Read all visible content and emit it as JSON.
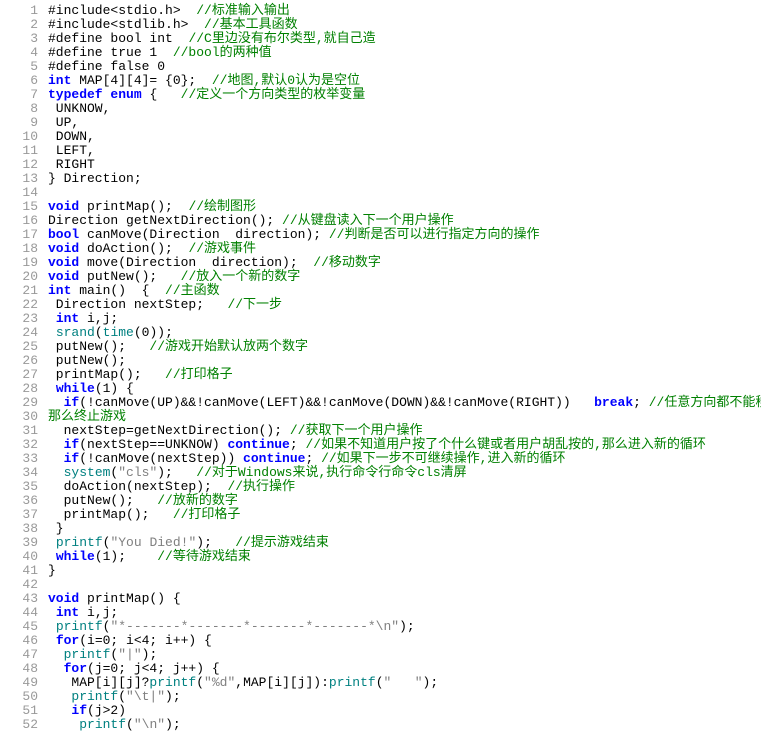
{
  "editor": {
    "lines": [
      {
        "n": 1,
        "segs": [
          {
            "c": "plain",
            "t": "#include<stdio.h>  "
          },
          {
            "c": "cmt",
            "t": "//标准输入输出"
          }
        ]
      },
      {
        "n": 2,
        "segs": [
          {
            "c": "plain",
            "t": "#include<stdlib.h>  "
          },
          {
            "c": "cmt",
            "t": "//基本工具函数"
          }
        ]
      },
      {
        "n": 3,
        "segs": [
          {
            "c": "plain",
            "t": "#define bool int  "
          },
          {
            "c": "cmt",
            "t": "//C里边没有布尔类型,就自己造"
          }
        ]
      },
      {
        "n": 4,
        "segs": [
          {
            "c": "plain",
            "t": "#define true 1  "
          },
          {
            "c": "cmt",
            "t": "//bool的两种值"
          }
        ]
      },
      {
        "n": 5,
        "segs": [
          {
            "c": "plain",
            "t": "#define false 0"
          }
        ]
      },
      {
        "n": 6,
        "segs": [
          {
            "c": "kw",
            "t": "int"
          },
          {
            "c": "plain",
            "t": " MAP[4][4]= {0};  "
          },
          {
            "c": "cmt",
            "t": "//地图,默认0认为是空位"
          }
        ]
      },
      {
        "n": 7,
        "segs": [
          {
            "c": "kw2",
            "t": "typedef"
          },
          {
            "c": "plain",
            "t": " "
          },
          {
            "c": "kw2",
            "t": "enum"
          },
          {
            "c": "plain",
            "t": " {   "
          },
          {
            "c": "cmt",
            "t": "//定义一个方向类型的枚举变量"
          }
        ]
      },
      {
        "n": 8,
        "segs": [
          {
            "c": "plain",
            "t": " UNKNOW,"
          }
        ]
      },
      {
        "n": 9,
        "segs": [
          {
            "c": "plain",
            "t": " UP,"
          }
        ]
      },
      {
        "n": 10,
        "segs": [
          {
            "c": "plain",
            "t": " DOWN,"
          }
        ]
      },
      {
        "n": 11,
        "segs": [
          {
            "c": "plain",
            "t": " LEFT,"
          }
        ]
      },
      {
        "n": 12,
        "segs": [
          {
            "c": "plain",
            "t": " RIGHT"
          }
        ]
      },
      {
        "n": 13,
        "segs": [
          {
            "c": "plain",
            "t": "} Direction;"
          }
        ]
      },
      {
        "n": 14,
        "segs": [
          {
            "c": "plain",
            "t": ""
          }
        ]
      },
      {
        "n": 15,
        "segs": [
          {
            "c": "kw",
            "t": "void"
          },
          {
            "c": "plain",
            "t": " printMap();  "
          },
          {
            "c": "cmt",
            "t": "//绘制图形"
          }
        ]
      },
      {
        "n": 16,
        "segs": [
          {
            "c": "plain",
            "t": "Direction getNextDirection(); "
          },
          {
            "c": "cmt",
            "t": "//从键盘读入下一个用户操作"
          }
        ]
      },
      {
        "n": 17,
        "segs": [
          {
            "c": "kw",
            "t": "bool"
          },
          {
            "c": "plain",
            "t": " canMove(Direction  direction); "
          },
          {
            "c": "cmt",
            "t": "//判断是否可以进行指定方向的操作"
          }
        ]
      },
      {
        "n": 18,
        "segs": [
          {
            "c": "kw",
            "t": "void"
          },
          {
            "c": "plain",
            "t": " doAction();  "
          },
          {
            "c": "cmt",
            "t": "//游戏事件"
          }
        ]
      },
      {
        "n": 19,
        "segs": [
          {
            "c": "kw",
            "t": "void"
          },
          {
            "c": "plain",
            "t": " move(Direction  direction);  "
          },
          {
            "c": "cmt",
            "t": "//移动数字"
          }
        ]
      },
      {
        "n": 20,
        "segs": [
          {
            "c": "kw",
            "t": "void"
          },
          {
            "c": "plain",
            "t": " putNew();   "
          },
          {
            "c": "cmt",
            "t": "//放入一个新的数字"
          }
        ]
      },
      {
        "n": 21,
        "segs": [
          {
            "c": "kw",
            "t": "int"
          },
          {
            "c": "plain",
            "t": " main()  {  "
          },
          {
            "c": "cmt",
            "t": "//主函数"
          }
        ]
      },
      {
        "n": 22,
        "segs": [
          {
            "c": "plain",
            "t": " Direction nextStep;   "
          },
          {
            "c": "cmt",
            "t": "//下一步"
          }
        ]
      },
      {
        "n": 23,
        "segs": [
          {
            "c": "plain",
            "t": " "
          },
          {
            "c": "kw",
            "t": "int"
          },
          {
            "c": "plain",
            "t": " i,j;"
          }
        ]
      },
      {
        "n": 24,
        "segs": [
          {
            "c": "plain",
            "t": " "
          },
          {
            "c": "teal",
            "t": "srand"
          },
          {
            "c": "plain",
            "t": "("
          },
          {
            "c": "teal",
            "t": "time"
          },
          {
            "c": "plain",
            "t": "(0));"
          }
        ]
      },
      {
        "n": 25,
        "segs": [
          {
            "c": "plain",
            "t": " putNew();   "
          },
          {
            "c": "cmt",
            "t": "//游戏开始默认放两个数字"
          }
        ]
      },
      {
        "n": 26,
        "segs": [
          {
            "c": "plain",
            "t": " putNew();"
          }
        ]
      },
      {
        "n": 27,
        "segs": [
          {
            "c": "plain",
            "t": " printMap();   "
          },
          {
            "c": "cmt",
            "t": "//打印格子"
          }
        ]
      },
      {
        "n": 28,
        "segs": [
          {
            "c": "plain",
            "t": " "
          },
          {
            "c": "kw",
            "t": "while"
          },
          {
            "c": "plain",
            "t": "(1) {"
          }
        ]
      },
      {
        "n": 29,
        "segs": [
          {
            "c": "plain",
            "t": "  "
          },
          {
            "c": "kw",
            "t": "if"
          },
          {
            "c": "plain",
            "t": "(!canMove(UP)&&!canMove(LEFT)&&!canMove(DOWN)&&!canMove(RIGHT))   "
          },
          {
            "c": "kw",
            "t": "break"
          },
          {
            "c": "plain",
            "t": "; "
          },
          {
            "c": "cmt",
            "t": "//任意方向都不能移动,"
          }
        ]
      },
      {
        "n": 30,
        "segs": [
          {
            "c": "cmt",
            "t": "那么终止游戏"
          }
        ]
      },
      {
        "n": 31,
        "segs": [
          {
            "c": "plain",
            "t": "  nextStep=getNextDirection(); "
          },
          {
            "c": "cmt",
            "t": "//获取下一个用户操作"
          }
        ]
      },
      {
        "n": 32,
        "segs": [
          {
            "c": "plain",
            "t": "  "
          },
          {
            "c": "kw",
            "t": "if"
          },
          {
            "c": "plain",
            "t": "(nextStep==UNKNOW) "
          },
          {
            "c": "kw",
            "t": "continue"
          },
          {
            "c": "plain",
            "t": "; "
          },
          {
            "c": "cmt",
            "t": "//如果不知道用户按了个什么键或者用户胡乱按的,那么进入新的循环"
          }
        ]
      },
      {
        "n": 33,
        "segs": [
          {
            "c": "plain",
            "t": "  "
          },
          {
            "c": "kw",
            "t": "if"
          },
          {
            "c": "plain",
            "t": "(!canMove(nextStep)) "
          },
          {
            "c": "kw",
            "t": "continue"
          },
          {
            "c": "plain",
            "t": "; "
          },
          {
            "c": "cmt",
            "t": "//如果下一步不可继续操作,进入新的循环"
          }
        ]
      },
      {
        "n": 34,
        "segs": [
          {
            "c": "plain",
            "t": "  "
          },
          {
            "c": "teal",
            "t": "system"
          },
          {
            "c": "plain",
            "t": "("
          },
          {
            "c": "str",
            "t": "\"cls\""
          },
          {
            "c": "plain",
            "t": ");   "
          },
          {
            "c": "cmt",
            "t": "//对于Windows来说,执行命令行命令cls清屏"
          }
        ]
      },
      {
        "n": 35,
        "segs": [
          {
            "c": "plain",
            "t": "  doAction(nextStep);  "
          },
          {
            "c": "cmt",
            "t": "//执行操作"
          }
        ]
      },
      {
        "n": 36,
        "segs": [
          {
            "c": "plain",
            "t": "  putNew();   "
          },
          {
            "c": "cmt",
            "t": "//放新的数字"
          }
        ]
      },
      {
        "n": 37,
        "segs": [
          {
            "c": "plain",
            "t": "  printMap();   "
          },
          {
            "c": "cmt",
            "t": "//打印格子"
          }
        ]
      },
      {
        "n": 38,
        "segs": [
          {
            "c": "plain",
            "t": " }"
          }
        ]
      },
      {
        "n": 39,
        "segs": [
          {
            "c": "plain",
            "t": " "
          },
          {
            "c": "teal",
            "t": "printf"
          },
          {
            "c": "plain",
            "t": "("
          },
          {
            "c": "str",
            "t": "\"You Died!\""
          },
          {
            "c": "plain",
            "t": ");   "
          },
          {
            "c": "cmt",
            "t": "//提示游戏结束"
          }
        ]
      },
      {
        "n": 40,
        "segs": [
          {
            "c": "plain",
            "t": " "
          },
          {
            "c": "kw",
            "t": "while"
          },
          {
            "c": "plain",
            "t": "(1);    "
          },
          {
            "c": "cmt",
            "t": "//等待游戏结束"
          }
        ]
      },
      {
        "n": 41,
        "segs": [
          {
            "c": "plain",
            "t": "}"
          }
        ]
      },
      {
        "n": 42,
        "segs": [
          {
            "c": "plain",
            "t": ""
          }
        ]
      },
      {
        "n": 43,
        "segs": [
          {
            "c": "kw",
            "t": "void"
          },
          {
            "c": "plain",
            "t": " printMap() {"
          }
        ]
      },
      {
        "n": 44,
        "segs": [
          {
            "c": "plain",
            "t": " "
          },
          {
            "c": "kw",
            "t": "int"
          },
          {
            "c": "plain",
            "t": " i,j;"
          }
        ]
      },
      {
        "n": 45,
        "segs": [
          {
            "c": "plain",
            "t": " "
          },
          {
            "c": "teal",
            "t": "printf"
          },
          {
            "c": "plain",
            "t": "("
          },
          {
            "c": "str",
            "t": "\"*-------*-------*-------*-------*\\n\""
          },
          {
            "c": "plain",
            "t": ");"
          }
        ]
      },
      {
        "n": 46,
        "segs": [
          {
            "c": "plain",
            "t": " "
          },
          {
            "c": "kw",
            "t": "for"
          },
          {
            "c": "plain",
            "t": "(i=0; i<4; i++) {"
          }
        ]
      },
      {
        "n": 47,
        "segs": [
          {
            "c": "plain",
            "t": "  "
          },
          {
            "c": "teal",
            "t": "printf"
          },
          {
            "c": "plain",
            "t": "("
          },
          {
            "c": "str",
            "t": "\"|\""
          },
          {
            "c": "plain",
            "t": ");"
          }
        ]
      },
      {
        "n": 48,
        "segs": [
          {
            "c": "plain",
            "t": "  "
          },
          {
            "c": "kw",
            "t": "for"
          },
          {
            "c": "plain",
            "t": "(j=0; j<4; j++) {"
          }
        ]
      },
      {
        "n": 49,
        "segs": [
          {
            "c": "plain",
            "t": "   MAP[i][j]?"
          },
          {
            "c": "teal",
            "t": "printf"
          },
          {
            "c": "plain",
            "t": "("
          },
          {
            "c": "str",
            "t": "\"%d\""
          },
          {
            "c": "plain",
            "t": ",MAP[i][j]):"
          },
          {
            "c": "teal",
            "t": "printf"
          },
          {
            "c": "plain",
            "t": "("
          },
          {
            "c": "str",
            "t": "\"   \""
          },
          {
            "c": "plain",
            "t": ");"
          }
        ]
      },
      {
        "n": 50,
        "segs": [
          {
            "c": "plain",
            "t": "   "
          },
          {
            "c": "teal",
            "t": "printf"
          },
          {
            "c": "plain",
            "t": "("
          },
          {
            "c": "str",
            "t": "\"\\t|\""
          },
          {
            "c": "plain",
            "t": ");"
          }
        ]
      },
      {
        "n": 51,
        "segs": [
          {
            "c": "plain",
            "t": "   "
          },
          {
            "c": "kw",
            "t": "if"
          },
          {
            "c": "plain",
            "t": "(j>2)"
          }
        ]
      },
      {
        "n": 52,
        "segs": [
          {
            "c": "plain",
            "t": "    "
          },
          {
            "c": "teal",
            "t": "printf"
          },
          {
            "c": "plain",
            "t": "("
          },
          {
            "c": "str",
            "t": "\"\\n\""
          },
          {
            "c": "plain",
            "t": ");"
          }
        ]
      }
    ]
  }
}
